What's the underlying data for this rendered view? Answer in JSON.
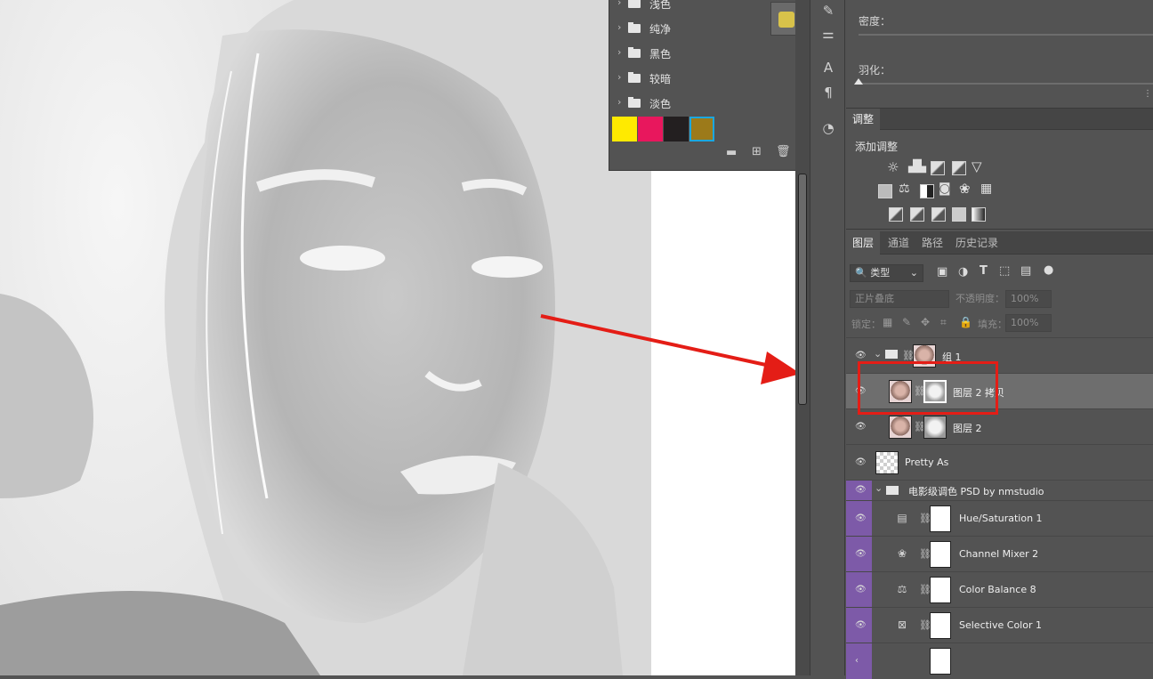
{
  "swatches_panel": {
    "groups": [
      {
        "label": "浅色"
      },
      {
        "label": "纯净"
      },
      {
        "label": "黑色"
      },
      {
        "label": "较暗"
      },
      {
        "label": "淡色"
      }
    ],
    "colors": [
      "#ffea00",
      "#e8175d",
      "#231f20",
      "#9c7a1a"
    ]
  },
  "properties": {
    "density_label": "密度：",
    "feather_label": "羽化："
  },
  "adjustments": {
    "tab": "调整",
    "title": "添加调整"
  },
  "layers_panel": {
    "tabs": [
      "图层",
      "通道",
      "路径",
      "历史记录"
    ],
    "filter_kind": "类型",
    "blend_mode": "正片叠底",
    "opacity_label": "不透明度：",
    "opacity_value": "100%",
    "lock_label": "锁定：",
    "fill_label": "填充：",
    "fill_value": "100%",
    "layers": [
      {
        "name": "组 1"
      },
      {
        "name": "图层 2 拷贝"
      },
      {
        "name": "图层 2"
      },
      {
        "name": "Pretty As"
      },
      {
        "name": "电影级调色  PSD by nmstudio"
      },
      {
        "name": "Hue/Saturation 1"
      },
      {
        "name": "Channel Mixer 2"
      },
      {
        "name": "Color Balance 8"
      },
      {
        "name": "Selective Color 1"
      }
    ]
  },
  "colors": {
    "accent_red": "#e41d16",
    "group_purple": "#7d5aa8"
  }
}
